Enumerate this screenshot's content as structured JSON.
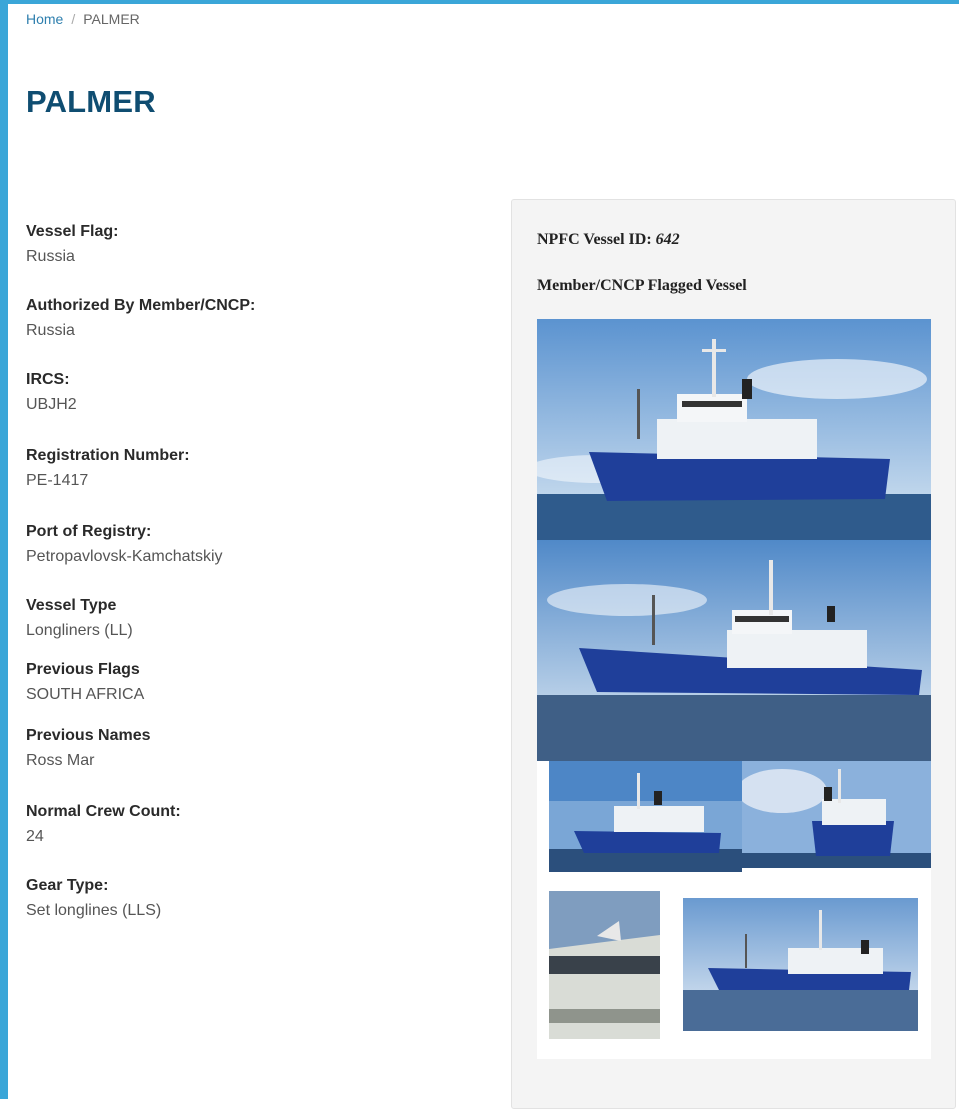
{
  "breadcrumb": {
    "home": "Home",
    "separator": "/",
    "current": "PALMER"
  },
  "title": "PALMER",
  "fields": [
    {
      "label": "Vessel Flag:",
      "value": "Russia"
    },
    {
      "label": "Authorized By Member/CNCP:",
      "value": "Russia"
    },
    {
      "label": "IRCS:",
      "value": "UBJH2"
    },
    {
      "label": "Registration Number:",
      "value": "PE-1417"
    },
    {
      "label": "Port of Registry:",
      "value": "Petropavlovsk-Kamchatskiy"
    },
    {
      "label": "Vessel Type",
      "value": "Longliners (LL)"
    },
    {
      "label": "Previous Flags",
      "value": "SOUTH AFRICA"
    },
    {
      "label": "Previous Names",
      "value": "Ross Mar"
    },
    {
      "label": "Normal Crew Count:",
      "value": "24"
    },
    {
      "label": "Gear Type:",
      "value": "Set longlines (LLS)"
    }
  ],
  "panel": {
    "id_label": "NPFC Vessel ID:",
    "id_value": "642",
    "subtitle": "Member/CNCP Flagged Vessel"
  },
  "colors": {
    "accent": "#3aa6d8",
    "title": "#0f4d71",
    "link": "#2e7fae",
    "hull": "#1f3f9a"
  }
}
